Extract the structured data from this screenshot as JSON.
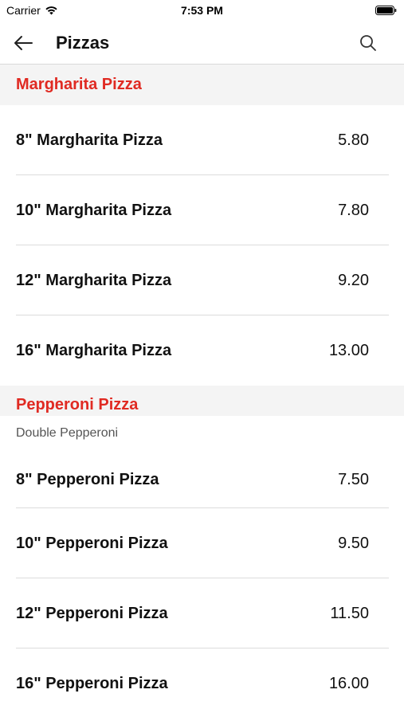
{
  "status_bar": {
    "carrier": "Carrier",
    "time": "7:53 PM",
    "icons": [
      "wifi-icon",
      "battery-icon"
    ]
  },
  "nav": {
    "title": "Pizzas",
    "back_icon": "back-arrow-icon",
    "search_icon": "search-icon"
  },
  "colors": {
    "accent": "#e02a22",
    "section_bg": "#f4f4f4",
    "divider": "#dcdcdc"
  },
  "sections": [
    {
      "title": "Margharita Pizza",
      "description": "",
      "items": [
        {
          "name": "8\" Margharita Pizza",
          "price": "5.80"
        },
        {
          "name": "10\" Margharita Pizza",
          "price": "7.80"
        },
        {
          "name": "12\" Margharita Pizza",
          "price": "9.20"
        },
        {
          "name": "16\" Margharita Pizza",
          "price": "13.00"
        }
      ]
    },
    {
      "title": "Pepperoni Pizza",
      "description": "Double Pepperoni",
      "items": [
        {
          "name": "8\" Pepperoni Pizza",
          "price": "7.50"
        },
        {
          "name": "10\" Pepperoni Pizza",
          "price": "9.50"
        },
        {
          "name": "12\" Pepperoni Pizza",
          "price": "11.50"
        },
        {
          "name": "16\" Pepperoni Pizza",
          "price": "16.00"
        }
      ]
    }
  ]
}
